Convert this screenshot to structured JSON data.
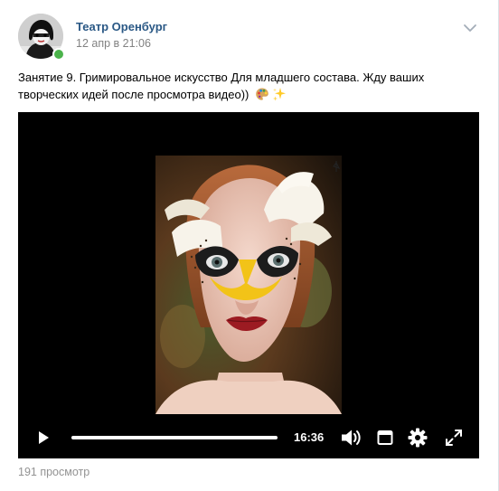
{
  "post": {
    "author": "Театр Оренбург",
    "date": "12 апр в 21:06",
    "text": "Занятие 9. Гримировальное искусство Для младшего состава. Жду ваших творческих идей после просмотра видео))",
    "emojis": [
      "palette-icon",
      "sparkles-icon"
    ],
    "views": "191 просмотр"
  },
  "video": {
    "duration": "16:36",
    "progress": 1.0,
    "controls": [
      "play-icon",
      "volume-icon",
      "miniplayer-icon",
      "settings-icon",
      "fullscreen-icon"
    ]
  },
  "colors": {
    "author_link": "#2a5885",
    "meta_gray": "#828282",
    "online": "#4bb34b"
  }
}
